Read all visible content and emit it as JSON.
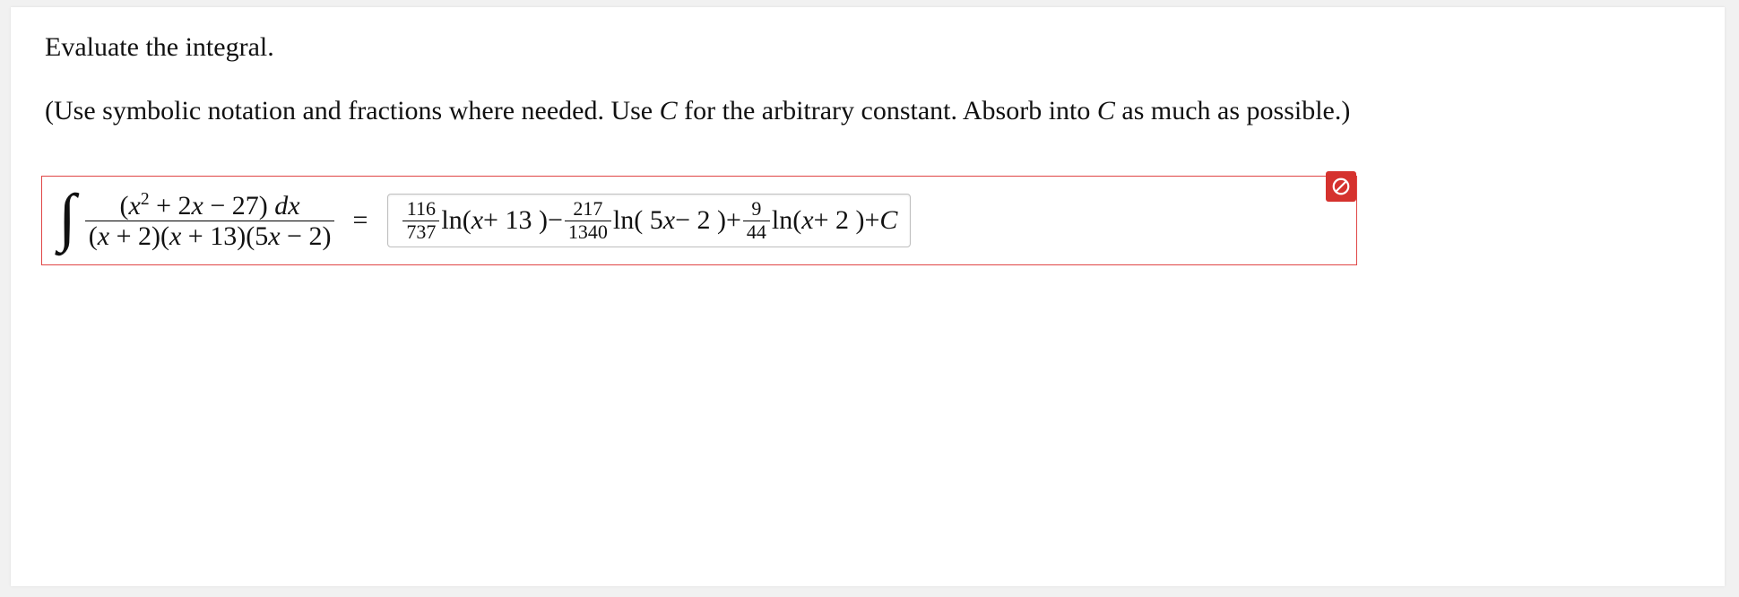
{
  "prompt": {
    "line1": "Evaluate the integral.",
    "line2_pre": "(Use symbolic notation and fractions where needed. Use ",
    "line2_c1": "C",
    "line2_mid": " for the arbitrary constant. Absorb into ",
    "line2_c2": "C",
    "line2_post": " as much as possible.)"
  },
  "integral": {
    "numerator": {
      "lparen": "(",
      "x": "x",
      "sq": "2",
      "plus": " + ",
      "two": "2",
      "x2": "x",
      "minus": " − ",
      "twentyseven": "27",
      "rparen": ")",
      "space": " ",
      "d": "d",
      "x3": "x"
    },
    "denominator": {
      "text1": "(",
      "x1": "x",
      "text2": " + 2)(",
      "x2": "x",
      "text3": " + 13)(5",
      "x3": "x",
      "text4": " − 2)"
    },
    "equals": "="
  },
  "answer": {
    "t1_num": "116",
    "t1_den": "737",
    "ln": " ln",
    "t1_arg_pre": "(",
    "t1_arg_x": "x",
    "t1_arg_post": " + 13 )",
    "minus": " − ",
    "t2_num": "217",
    "t2_den": "1340",
    "t2_arg_pre": "( 5",
    "t2_arg_x": "x",
    "t2_arg_post": " − 2 )",
    "plus": " + ",
    "t3_num": "9",
    "t3_den": "44",
    "t3_arg_pre": "(",
    "t3_arg_x": "x",
    "t3_arg_post": " + 2 )",
    "plusC": " + ",
    "C": "C"
  },
  "status": {
    "icon": "incorrect"
  }
}
